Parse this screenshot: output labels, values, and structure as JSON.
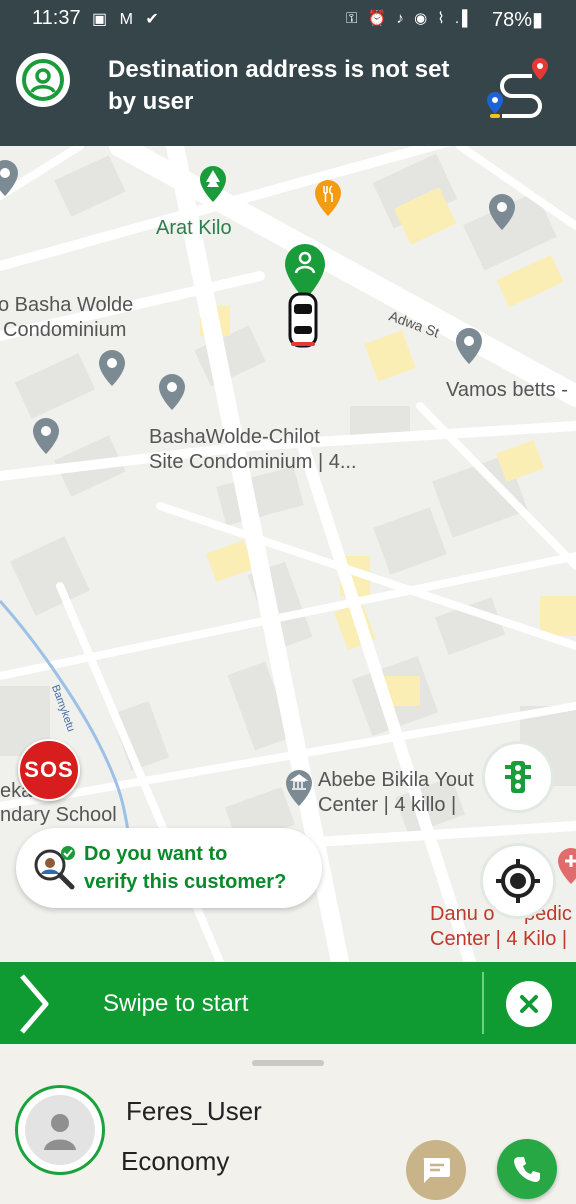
{
  "status_bar": {
    "time": "11:37",
    "left_icons": "▣ M ✔",
    "right_icons": "⚿ ⏰ ♪ ◉ ⌇ .▌",
    "battery": "78%▮"
  },
  "header": {
    "title": "Destination address is not set by user",
    "profile_icon": "user-circle-icon",
    "route_icon": "route-icon"
  },
  "map": {
    "labels": {
      "arat_kilo": "Arat Kilo",
      "basha_wolde_1": "o Basha Wolde",
      "basha_wolde_2": "Condominium",
      "adwa_st": "Adwa St",
      "vamos": "Vamos betts -",
      "bashawolde_chilot_1": "BashaWolde-Chilot",
      "bashawolde_chilot_2": "Site Condominium | 4...",
      "abebe_1": "Abebe Bikila Yout",
      "abebe_2": "Center | 4 killo |",
      "school_1": "eka",
      "school_2": "ndary School",
      "danu_1": "Danu o",
      "danu_1b": "pedic",
      "danu_2": "Center | 4 Kilo |",
      "river": "Bamyketu"
    },
    "colors": {
      "road": "#ffffff",
      "block": "#e3e3df",
      "yellow_block": "#fbeeb5",
      "pin_gray": "#7c8a94",
      "green": "#1a9c3a"
    }
  },
  "sos": {
    "label": "SOS"
  },
  "verify": {
    "line1": "Do you want to",
    "line2": "verify this customer?"
  },
  "swipe": {
    "label": "Swipe to start"
  },
  "customer": {
    "name": "Feres_User",
    "ride_type": "Economy"
  }
}
